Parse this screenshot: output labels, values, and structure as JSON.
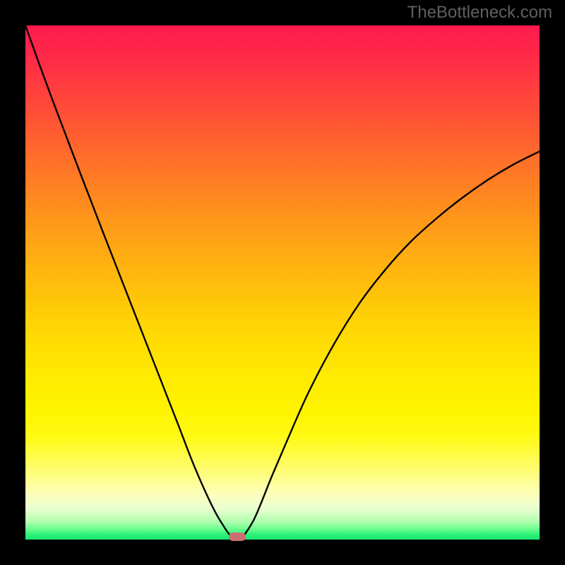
{
  "watermark_text": "TheBottleneck.com",
  "colors": {
    "frame": "#000000",
    "curve": "#000000",
    "marker": "#cc6f72",
    "gradient_top": "#fe1a4e",
    "gradient_bottom": "#14e872"
  },
  "chart_data": {
    "type": "line",
    "title": "",
    "xlabel": "",
    "ylabel": "",
    "xlim": [
      0,
      1
    ],
    "ylim": [
      0,
      1
    ],
    "x": [
      0.0,
      0.025,
      0.05,
      0.075,
      0.1,
      0.125,
      0.15,
      0.175,
      0.2,
      0.225,
      0.25,
      0.275,
      0.3,
      0.325,
      0.35,
      0.37,
      0.385,
      0.395,
      0.405,
      0.412,
      0.42,
      0.43,
      0.445,
      0.46,
      0.48,
      0.51,
      0.55,
      0.6,
      0.65,
      0.7,
      0.75,
      0.8,
      0.85,
      0.9,
      0.95,
      1.0
    ],
    "values": [
      1.0,
      0.93,
      0.862,
      0.796,
      0.73,
      0.665,
      0.6,
      0.536,
      0.472,
      0.408,
      0.344,
      0.28,
      0.216,
      0.151,
      0.093,
      0.052,
      0.027,
      0.012,
      0.003,
      0.0,
      0.003,
      0.015,
      0.04,
      0.075,
      0.125,
      0.195,
      0.285,
      0.38,
      0.46,
      0.525,
      0.58,
      0.625,
      0.665,
      0.7,
      0.73,
      0.755
    ],
    "marker": {
      "x": 0.412,
      "y": 0.006
    },
    "legend": [],
    "grid": false
  }
}
